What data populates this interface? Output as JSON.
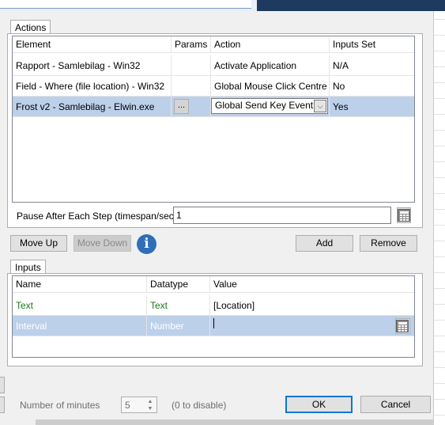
{
  "actions_tab": {
    "label": "Actions"
  },
  "actions_grid": {
    "columns": [
      "Element",
      "Params",
      "Action",
      "Inputs Set"
    ],
    "rows": [
      {
        "element": "Rapport - Samlebilag - Win32",
        "params": "",
        "action": "Activate Application",
        "inputs_set": "N/A",
        "selected": false
      },
      {
        "element": "Field - Where (file location) - Win32",
        "params": "",
        "action": "Global Mouse Click Centre",
        "inputs_set": "No",
        "selected": false
      },
      {
        "element": "Frost v2 - Samlebilag - Elwin.exe",
        "params": "...",
        "action": "Global  Send  Key Event",
        "inputs_set": "Yes",
        "selected": true
      }
    ]
  },
  "pause": {
    "label": "Pause After Each Step (timespan/secs)",
    "value": "1"
  },
  "buttons": {
    "move_up": "Move Up",
    "move_down": "Move Down",
    "add": "Add",
    "remove": "Remove",
    "ok": "OK",
    "cancel": "Cancel"
  },
  "inputs_tab": {
    "label": "Inputs"
  },
  "inputs_grid": {
    "columns": [
      "Name",
      "Datatype",
      "Value"
    ],
    "rows": [
      {
        "name": "Text",
        "datatype": "Text",
        "value": "[Location]",
        "selected": false
      },
      {
        "name": "Interval",
        "datatype": "Number",
        "value": "",
        "selected": true
      }
    ]
  },
  "footer": {
    "minutes_label": "Number of minutes",
    "minutes_value": "5",
    "disable_hint": "(0 to disable)"
  },
  "colors": {
    "selection": "#bcd0ea",
    "accent": "#0078d7",
    "green_text": "#1a7a1a",
    "info_icon": "#2f6fba"
  }
}
